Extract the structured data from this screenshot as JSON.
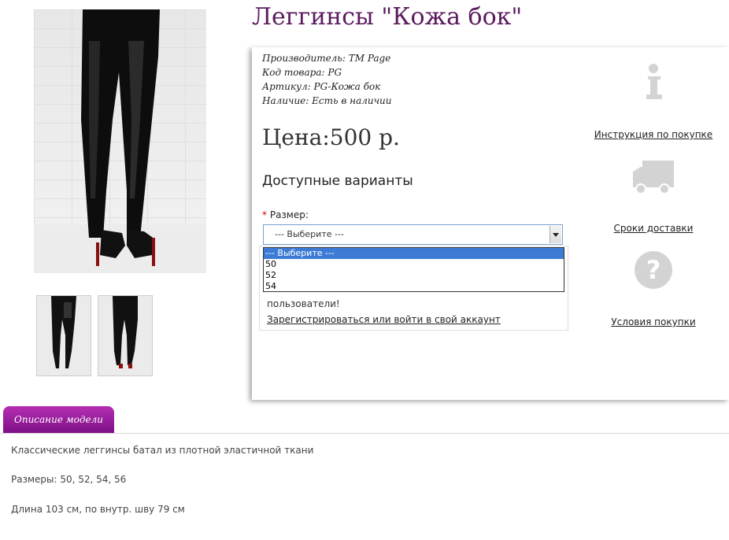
{
  "product": {
    "title": "Леггинсы \"Кожа бок\"",
    "meta": [
      {
        "label": "Производитель:",
        "value": "TM Page"
      },
      {
        "label": "Код товара:",
        "value": "PG"
      },
      {
        "label": "Артикул:",
        "value": "PG-Кожа бок"
      },
      {
        "label": "Наличие:",
        "value": "Есть в наличии"
      }
    ],
    "price": "Цена:500 р."
  },
  "options": {
    "heading": "Доступные варианты",
    "size_label": "Размер:",
    "required_mark": "*",
    "selected": "--- Выберите ---",
    "dropdown": [
      "--- Выберите ---",
      "50",
      "52",
      "54"
    ]
  },
  "register": {
    "text": "пользователи!",
    "link": "Зарегистрироваться или войти в свой аккаунт"
  },
  "side_links": [
    {
      "icon": "info-icon",
      "label": "Инструкция по покупке"
    },
    {
      "icon": "truck-icon",
      "label": "Сроки доставки"
    },
    {
      "icon": "question-icon",
      "label": "Условия покупки"
    }
  ],
  "tabs": [
    {
      "label": "Описание модели"
    }
  ],
  "description": [
    "Классические леггинсы батал из плотной эластичной ткани",
    "Размеры: 50, 52, 54, 56",
    "Длина 103 см, по внутр. шву 79 см"
  ],
  "colors": {
    "title": "#5a1a5e",
    "tab": "#9a1aa0",
    "dropdown_selected": "#3d7cd6",
    "icon_gray": "#d3d3d3"
  }
}
